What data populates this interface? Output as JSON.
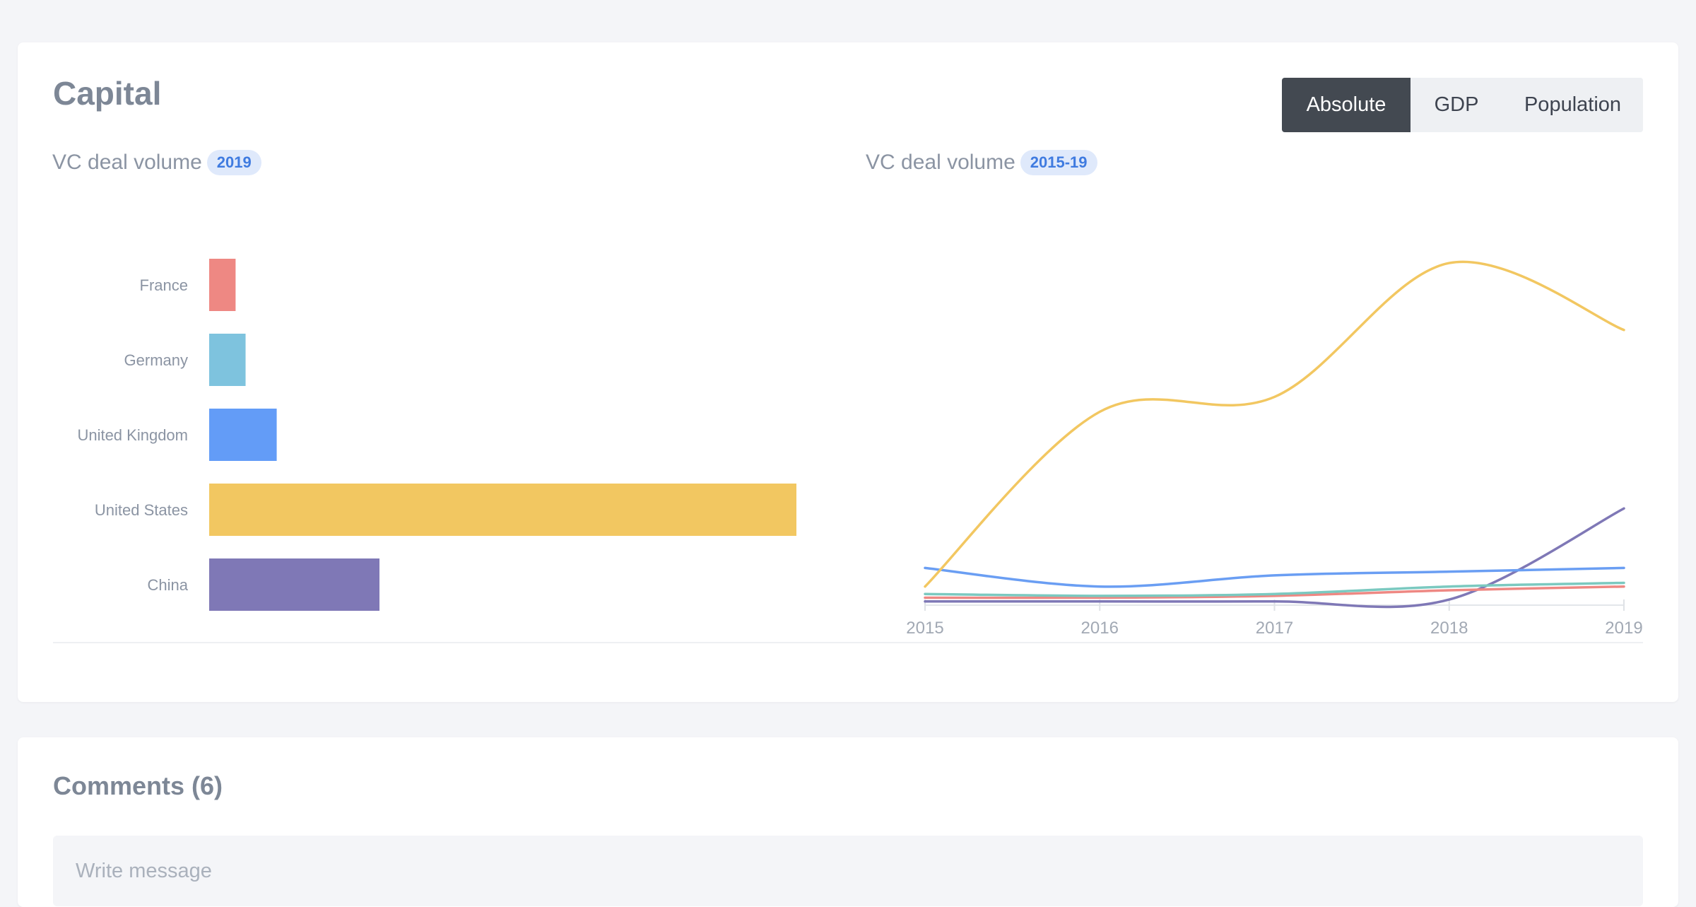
{
  "capital": {
    "title": "Capital",
    "toggles": [
      "Absolute",
      "GDP",
      "Population"
    ],
    "active_toggle": "Absolute"
  },
  "bar_chart": {
    "heading": "VC deal volume",
    "badge": "2019"
  },
  "line_chart": {
    "heading": "VC deal volume",
    "badge": "2015-19"
  },
  "comments": {
    "title": "Comments (6)",
    "placeholder": "Write message"
  },
  "chart_data": [
    {
      "type": "bar",
      "orientation": "horizontal",
      "categories": [
        "France",
        "Germany",
        "United Kingdom",
        "United States",
        "China"
      ],
      "values": [
        4.5,
        6.2,
        11.5,
        100,
        29
      ],
      "colors": [
        "#ee8883",
        "#7ec3de",
        "#639cf7",
        "#f2c761",
        "#7f78b6"
      ],
      "xlim": [
        0,
        100
      ],
      "grid": false,
      "legend": "none"
    },
    {
      "type": "line",
      "x": [
        "2015",
        "2016",
        "2017",
        "2018",
        "2019"
      ],
      "series": [
        {
          "color": "#f2c761",
          "values": [
            5,
            52,
            56,
            92,
            74
          ]
        },
        {
          "color": "#6a9ef3",
          "values": [
            10,
            5,
            8,
            9,
            10
          ]
        },
        {
          "color": "#7bc9c0",
          "values": [
            3,
            2.5,
            3,
            5,
            6
          ]
        },
        {
          "color": "#ee8883",
          "values": [
            2,
            2,
            2.5,
            4,
            5
          ]
        },
        {
          "color": "#7f78b6",
          "values": [
            1,
            1,
            1,
            1.5,
            26
          ]
        }
      ],
      "ylim": [
        0,
        100
      ],
      "grid": false,
      "legend": "none"
    }
  ]
}
